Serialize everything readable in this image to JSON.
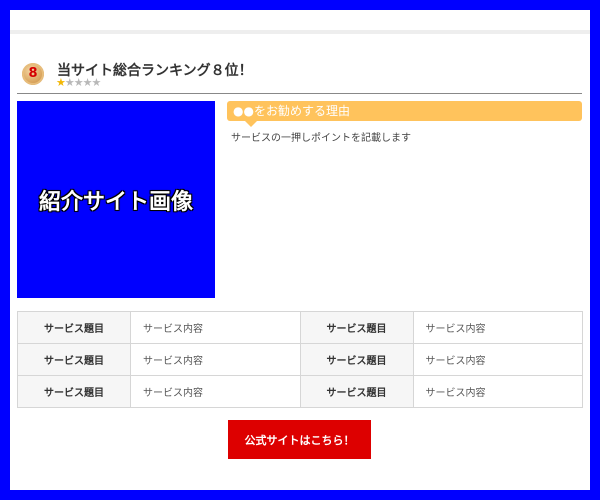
{
  "ranking": {
    "badge_number": "8",
    "title": "当サイト総合ランキング８位！",
    "rating": 1,
    "rating_max": 5,
    "star_on_color": "#f2b705",
    "star_off_color": "#b8b8b8"
  },
  "image": {
    "label": "紹介サイト画像",
    "background_color": "#0000ff"
  },
  "reason": {
    "header": "●●をお勧めする理由",
    "text": "サービスの一押しポイントを記載します",
    "accent_color": "#ffc35c"
  },
  "table": {
    "rows": [
      [
        {
          "label": "サービス題目",
          "value": "サービス内容"
        },
        {
          "label": "サービス題目",
          "value": "サービス内容"
        }
      ],
      [
        {
          "label": "サービス題目",
          "value": "サービス内容"
        },
        {
          "label": "サービス題目",
          "value": "サービス内容"
        }
      ],
      [
        {
          "label": "サービス題目",
          "value": "サービス内容"
        },
        {
          "label": "サービス題目",
          "value": "サービス内容"
        }
      ]
    ]
  },
  "cta": {
    "label": "公式サイトはこちら！",
    "color": "#dd0000"
  }
}
